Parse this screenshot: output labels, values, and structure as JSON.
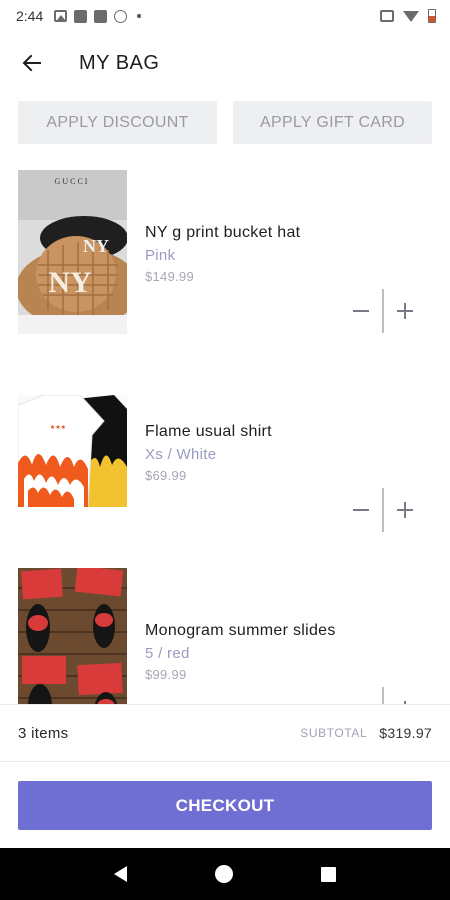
{
  "status_bar": {
    "time": "2:44"
  },
  "header": {
    "title": "MY BAG",
    "back_icon": "arrow-left-icon"
  },
  "actions": {
    "discount_label": "APPLY DISCOUNT",
    "gift_card_label": "APPLY GIFT CARD"
  },
  "items": [
    {
      "name": "NY g print bucket hat",
      "variant": "Pink",
      "price": "$149.99",
      "thumb_label": "GUCCI"
    },
    {
      "name": "Flame usual shirt",
      "variant": "Xs / White",
      "price": "$69.99"
    },
    {
      "name": "Monogram summer slides",
      "variant": "5 / red",
      "price": "$99.99"
    }
  ],
  "summary": {
    "items_count": "3 items",
    "subtotal_label": "SUBTOTAL",
    "subtotal_value": "$319.97"
  },
  "checkout": {
    "label": "CHECKOUT"
  },
  "colors": {
    "accent": "#6f6fd3",
    "variant_text": "#9a9bc3",
    "action_bg": "#eeeff0"
  }
}
